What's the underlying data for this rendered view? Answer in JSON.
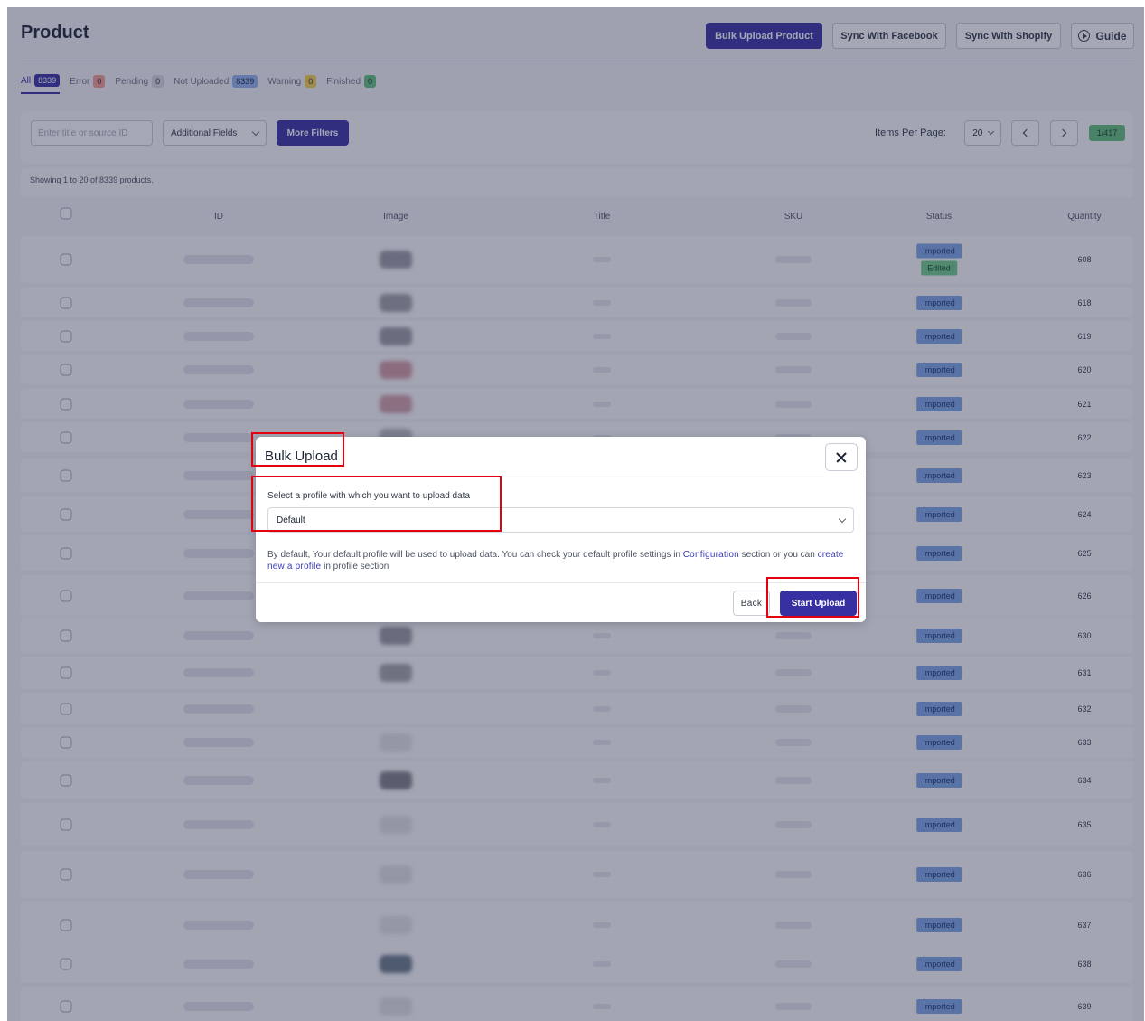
{
  "header": {
    "title": "Product",
    "buttons": {
      "bulk_upload": "Bulk Upload Product",
      "sync_facebook": "Sync With Facebook",
      "sync_shopify": "Sync With Shopify",
      "guide": "Guide"
    }
  },
  "status_tabs": [
    {
      "label": "All",
      "count": "8339",
      "active": true
    },
    {
      "label": "Error",
      "count": "0"
    },
    {
      "label": "Pending",
      "count": "0"
    },
    {
      "label": "Not Uploaded",
      "count": "8339"
    },
    {
      "label": "Warning",
      "count": "0"
    },
    {
      "label": "Finished",
      "count": "0"
    }
  ],
  "filters": {
    "search_placeholder": "Enter title or source ID",
    "additional_fields": "Additional Fields",
    "more_filters": "More Filters",
    "items_per_page_label": "Items Per Page:",
    "items_per_page_value": "20",
    "page_info": "1/417"
  },
  "showing_text": "Showing 1 to 20 of 8339 products.",
  "table": {
    "columns": [
      "ID",
      "Image",
      "Title",
      "SKU",
      "Status",
      "Quantity"
    ],
    "rows": [
      {
        "status": [
          "Imported",
          "Edited"
        ],
        "quantity": "608"
      },
      {
        "status": [
          "Imported"
        ],
        "quantity": "618"
      },
      {
        "status": [
          "Imported"
        ],
        "quantity": "619"
      },
      {
        "status": [
          "Imported"
        ],
        "quantity": "620"
      },
      {
        "status": [
          "Imported"
        ],
        "quantity": "621"
      },
      {
        "status": [
          "Imported"
        ],
        "quantity": "622"
      },
      {
        "status": [
          "Imported"
        ],
        "quantity": "623"
      },
      {
        "status": [
          "Imported"
        ],
        "quantity": "624"
      },
      {
        "status": [
          "Imported"
        ],
        "quantity": "625"
      },
      {
        "status": [
          "Imported"
        ],
        "quantity": "626"
      },
      {
        "status": [
          "Imported"
        ],
        "quantity": "630"
      },
      {
        "status": [
          "Imported"
        ],
        "quantity": "631"
      },
      {
        "status": [
          "Imported"
        ],
        "quantity": "632"
      },
      {
        "status": [
          "Imported"
        ],
        "quantity": "633"
      },
      {
        "status": [
          "Imported"
        ],
        "quantity": "634"
      },
      {
        "status": [
          "Imported"
        ],
        "quantity": "635"
      },
      {
        "status": [
          "Imported"
        ],
        "quantity": "636"
      },
      {
        "status": [
          "Imported"
        ],
        "quantity": "637"
      },
      {
        "status": [
          "Imported"
        ],
        "quantity": "638"
      },
      {
        "status": [
          "Imported"
        ],
        "quantity": "639"
      }
    ]
  },
  "modal": {
    "title": "Bulk Upload",
    "select_label": "Select a profile with which you want to upload data",
    "selected_profile": "Default",
    "info_prefix": "By default, Your default profile will be used to upload data. You can check your default profile settings in ",
    "info_link_configuration": "Configuration",
    "info_middle": " section or you can ",
    "info_link_create_profile": "create new a profile",
    "info_suffix": " in profile section",
    "back_label": "Back",
    "start_label": "Start Upload"
  },
  "colors": {
    "accent": "#3730a3",
    "highlight": "#e3000f",
    "status_imported": "#7fa6e6",
    "status_edited": "#6fcc8a"
  },
  "icons": [
    "close-icon",
    "chevron-down-icon",
    "play-circle-icon",
    "arrow-left-icon",
    "arrow-right-icon",
    "checkbox-icon"
  ]
}
